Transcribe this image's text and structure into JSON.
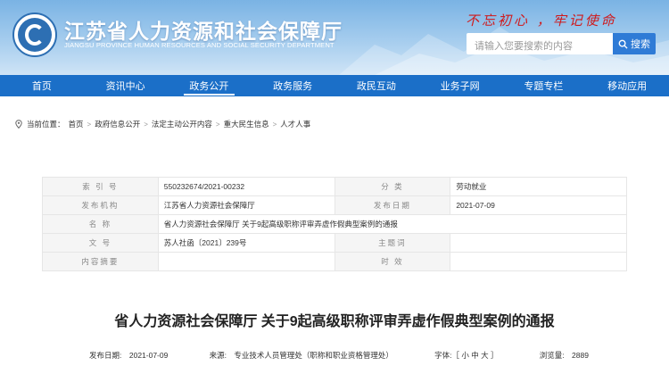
{
  "header": {
    "title": "江苏省人力资源和社会保障厅",
    "subtitle": "JIANGSU PROVINCE HUMAN RESOURCES AND SOCIAL SECURITY DEPARTMENT",
    "slogan": "不忘初心 ，牢记使命",
    "search_placeholder": "请输入您要搜索的内容",
    "search_button": "搜索"
  },
  "nav": {
    "items": [
      "首页",
      "资讯中心",
      "政务公开",
      "政务服务",
      "政民互动",
      "业务子网",
      "专题专栏",
      "移动应用"
    ],
    "active": "政务公开"
  },
  "breadcrumb": {
    "label": "当前位置：",
    "items": [
      "首页",
      "政府信息公开",
      "法定主动公开内容",
      "重大民生信息",
      "人才人事"
    ]
  },
  "info": {
    "index_label": "索 引 号",
    "index_value": "550232674/2021-00232",
    "category_label": "分 类",
    "category_value": "劳动就业",
    "org_label": "发布机构",
    "org_value": "江苏省人力资源社会保障厅",
    "date_label": "发布日期",
    "date_value": "2021-07-09",
    "name_label": "名 称",
    "name_value": "省人力资源社会保障厅 关于9起高级职称评审弄虚作假典型案例的通报",
    "docno_label": "文 号",
    "docno_value": "苏人社函〔2021〕239号",
    "keywords_label": "主题词",
    "keywords_value": "",
    "summary_label": "内容摘要",
    "summary_value": "",
    "validity_label": "时 效",
    "validity_value": ""
  },
  "article": {
    "title": "省人力资源社会保障厅 关于9起高级职称评审弄虚作假典型案例的通报"
  },
  "meta": {
    "date": "发布日期:　2021-07-09",
    "source": "来源:　专业技术人员管理处（职称和职业资格管理处）",
    "font_size": "字体:［ 小 中 大 ］",
    "views": "浏览量:　2889"
  },
  "colors": {
    "nav": "#1b6fc8",
    "slogan": "#d0191b",
    "search_button": "#2f7bd6"
  }
}
